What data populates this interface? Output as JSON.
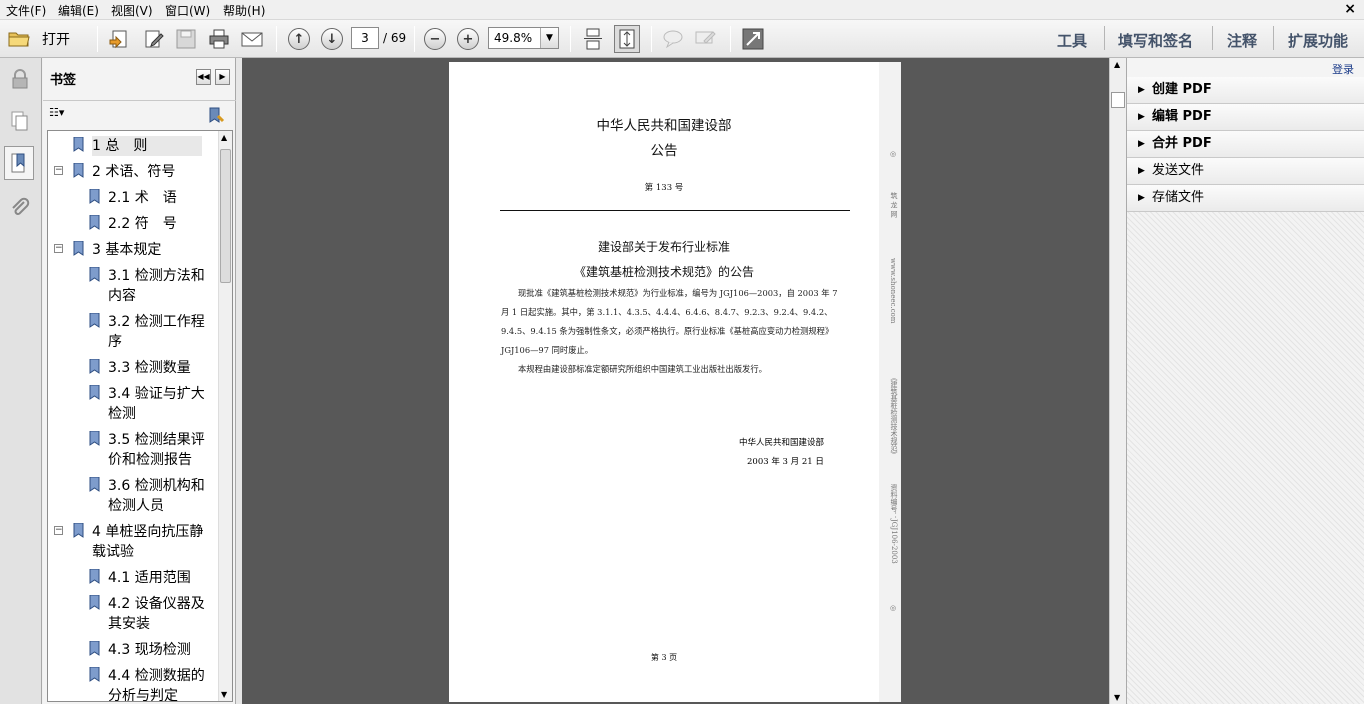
{
  "menu": [
    "文件(F)",
    "编辑(E)",
    "视图(V)",
    "窗口(W)",
    "帮助(H)"
  ],
  "window_close": "×",
  "toolbar": {
    "open_label": "打开",
    "page_current": "3",
    "page_total": "/ 69",
    "zoom": "49.8%",
    "tools": "工具",
    "fill_sign": "填写和签名",
    "comment": "注释",
    "extend": "扩展功能"
  },
  "bookmarks": {
    "title": "书签",
    "items": [
      {
        "label": "1 总　则"
      },
      {
        "label": "2 术语、符号",
        "toggle": "−"
      },
      {
        "label": "2.1 术　语"
      },
      {
        "label": "2.2 符　号"
      },
      {
        "label": "3 基本规定",
        "toggle": "−"
      },
      {
        "label": "3.1 检测方法和内容"
      },
      {
        "label": "3.2 检测工作程序"
      },
      {
        "label": "3.3 检测数量"
      },
      {
        "label": "3.4 验证与扩大检测"
      },
      {
        "label": "3.5 检测结果评价和检测报告"
      },
      {
        "label": "3.6 检测机构和检测人员"
      },
      {
        "label": "4 单桩竖向抗压静载试验",
        "toggle": "−"
      },
      {
        "label": "4.1 适用范围"
      },
      {
        "label": "4.2 设备仪器及其安装"
      },
      {
        "label": "4.3 现场检测"
      },
      {
        "label": "4.4 检测数据的分析与判定"
      }
    ]
  },
  "document": {
    "org_title": "中华人民共和国建设部",
    "announcement": "公告",
    "number": "第 133 号",
    "heading1": "建设部关于发布行业标准",
    "heading2": "《建筑基桩检测技术规范》的公告",
    "para1_l1": "现批准《建筑基桩检测技术规范》为行业标准，编号为 JGJ106—2003，自 2003 年 7",
    "para1_l2": "月 1 日起实施。其中，第 3.1.1、4.3.5、4.4.4、6.4.6、8.4.7、9.2.3、9.2.4、9.4.2、",
    "para1_l3": "9.4.5、9.4.15 条为强制性条文，必须严格执行。原行业标准《基桩高应变动力检测规程》",
    "para1_l4": "JGJ106—97 同时废止。",
    "para2": "本规程由建设部标准定额研究所组织中国建筑工业出版社出版发行。",
    "sign_org": "中华人民共和国建设部",
    "sign_date": "2003 年 3 月 21 日",
    "page_footer": "第 3 页",
    "margin_site": "筑 龙 网",
    "margin_url": "www.shoneec.com",
    "margin_title": "《建筑基桩检测技术规范》",
    "margin_code": "资料编号：JGJ106-2003"
  },
  "right_panel": {
    "login": "登录",
    "items": [
      "创建 PDF",
      "编辑 PDF",
      "合并 PDF",
      "发送文件",
      "存储文件"
    ]
  }
}
